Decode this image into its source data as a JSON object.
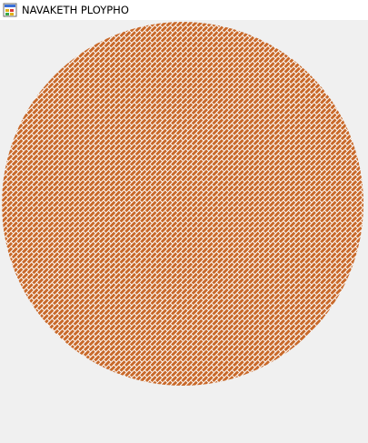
{
  "window": {
    "title": "NAVAKETH PLOYPHO",
    "icon": "form-app-icon"
  },
  "canvas": {
    "shape": "ellipse",
    "fill_pattern": "diagonal-brick",
    "fill_color": "#c8692a",
    "pattern_line_color": "#ffffff"
  }
}
